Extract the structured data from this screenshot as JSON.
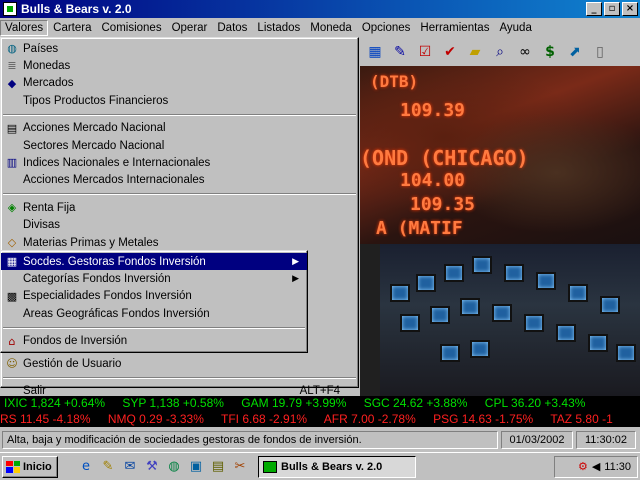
{
  "window": {
    "title": "Bulls & Bears v. 2.0",
    "btn_min": "_",
    "btn_max": "▫",
    "btn_close": "×"
  },
  "menubar": [
    "Valores",
    "Cartera",
    "Comisiones",
    "Operar",
    "Datos",
    "Listados",
    "Moneda",
    "Opciones",
    "Herramientas",
    "Ayuda"
  ],
  "valores_menu": {
    "g1": [
      "Países",
      "Monedas",
      "Mercados",
      "Tipos Productos Financieros"
    ],
    "g2": [
      "Acciones Mercado Nacional",
      "Sectores Mercado Nacional",
      "Indices Nacionales e Internacionales",
      "Acciones Mercados Internacionales"
    ],
    "g3": [
      "Renta Fija",
      "Divisas",
      "Materias Primas y Metales"
    ],
    "hidden_below_submenu": "Gestión de Usuario",
    "exit_label": "Salir",
    "exit_shortcut": "ALT+F4"
  },
  "submenu": {
    "items": [
      "Socdes. Gestoras Fondos Inversión",
      "Categorías Fondos Inversión",
      "Especialidades Fondos Inversión",
      "Areas Geográficas Fondos Inversión",
      "Fondos de Inversión"
    ],
    "arrow": "▶"
  },
  "photo_text": [
    "(DTB)",
    "109.39",
    "(OND (CHICAGO)",
    "104.00",
    "109.35",
    "A (MATIF"
  ],
  "ticker_top": [
    "IXIC 1,824 +0.64%",
    "SYP 1,138 +0.58%",
    "GAM 19.79 +3.99%",
    "SGC 24.62 +3.88%",
    "CPL 36.20 +3.43%"
  ],
  "ticker_bottom": [
    "RS 11.45 -4.18%",
    "NMQ 0.29 -3.33%",
    "TFI 6.68 -2.91%",
    "AFR 7.00 -2.78%",
    "PSG 14.63 -1.75%",
    "TAZ 5.80 -1"
  ],
  "statusbar": {
    "message": "Alta, baja y modificación de sociedades gestoras de fondos de inversión.",
    "date": "01/03/2002",
    "time": "11:30:02"
  },
  "taskbar": {
    "start_label": "Inicio",
    "task_label": "Bulls & Bears v. 2.0",
    "clock": "11:30"
  }
}
